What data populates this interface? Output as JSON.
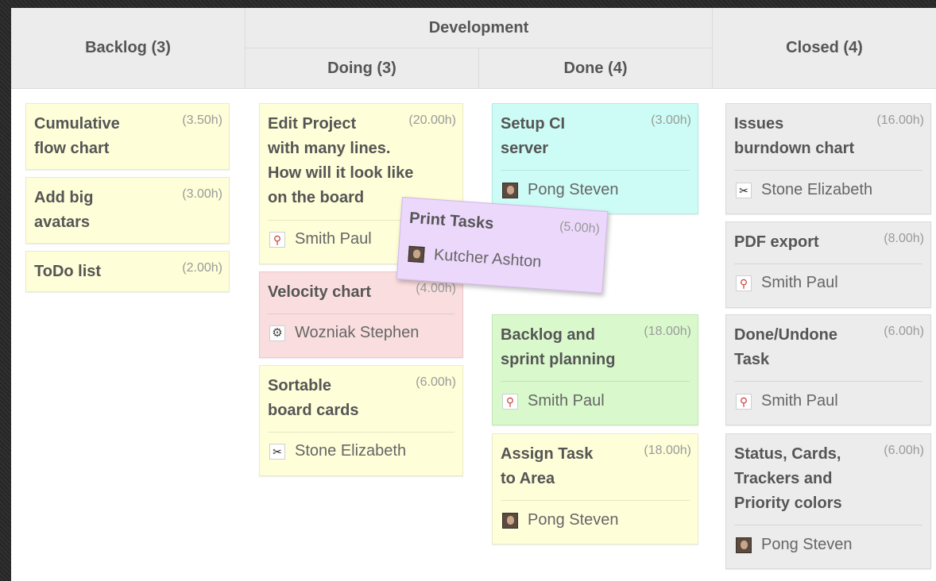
{
  "headers": {
    "backlog": "Backlog (3)",
    "development": "Development",
    "doing": "Doing (3)",
    "done": "Done (4)",
    "closed": "Closed (4)"
  },
  "backlog": [
    {
      "title": "Cumulative\nflow chart",
      "estimate": "(3.50h)"
    },
    {
      "title": "Add big\navatars",
      "estimate": "(3.00h)"
    },
    {
      "title": "ToDo list",
      "estimate": "(2.00h)"
    }
  ],
  "doing": [
    {
      "title": "Edit Project\nwith many lines.\nHow will it look like\non the board",
      "estimate": "(20.00h)",
      "assignee": "Smith Paul",
      "avatar_icon": "pin-avatar-icon"
    },
    {
      "title": "Velocity chart",
      "estimate": "(4.00h)",
      "assignee": "Wozniak Stephen",
      "avatar_icon": "cog-avatar-icon"
    },
    {
      "title": "Sortable\nboard cards",
      "estimate": "(6.00h)",
      "assignee": "Stone Elizabeth",
      "avatar_icon": "scissors-avatar-icon"
    }
  ],
  "done": [
    {
      "title": "Setup CI\nserver",
      "estimate": "(3.00h)",
      "assignee": "Pong Steven",
      "avatar_icon": "photo-avatar-icon"
    },
    {
      "title": "Backlog and\nsprint planning",
      "estimate": "(18.00h)",
      "assignee": "Smith Paul",
      "avatar_icon": "pin-avatar-icon"
    },
    {
      "title": "Assign Task\nto Area",
      "estimate": "(18.00h)",
      "assignee": "Pong Steven",
      "avatar_icon": "photo-avatar-icon"
    }
  ],
  "closed": [
    {
      "title": "Issues\nburndown chart",
      "estimate": "(16.00h)",
      "assignee": "Stone Elizabeth",
      "avatar_icon": "scissors-avatar-icon"
    },
    {
      "title": "PDF export",
      "estimate": "(8.00h)",
      "assignee": "Smith Paul",
      "avatar_icon": "pin-avatar-icon"
    },
    {
      "title": "Done/Undone\nTask",
      "estimate": "(6.00h)",
      "assignee": "Smith Paul",
      "avatar_icon": "pin-avatar-icon"
    },
    {
      "title": "Status, Cards,\nTrackers and\nPriority colors",
      "estimate": "(6.00h)",
      "assignee": "Pong Steven",
      "avatar_icon": "photo-avatar-icon"
    }
  ],
  "dragging": {
    "title": "Print Tasks",
    "estimate": "(5.00h)",
    "assignee": "Kutcher Ashton",
    "avatar_icon": "photo-avatar-icon"
  },
  "colors": {
    "yellow": "#fefed9",
    "cyan": "#ccfcf5",
    "pink": "#fadedf",
    "green": "#d9f9cc",
    "gray": "#ececec",
    "lilac": "#ecd8fb",
    "header": "#ececec"
  }
}
